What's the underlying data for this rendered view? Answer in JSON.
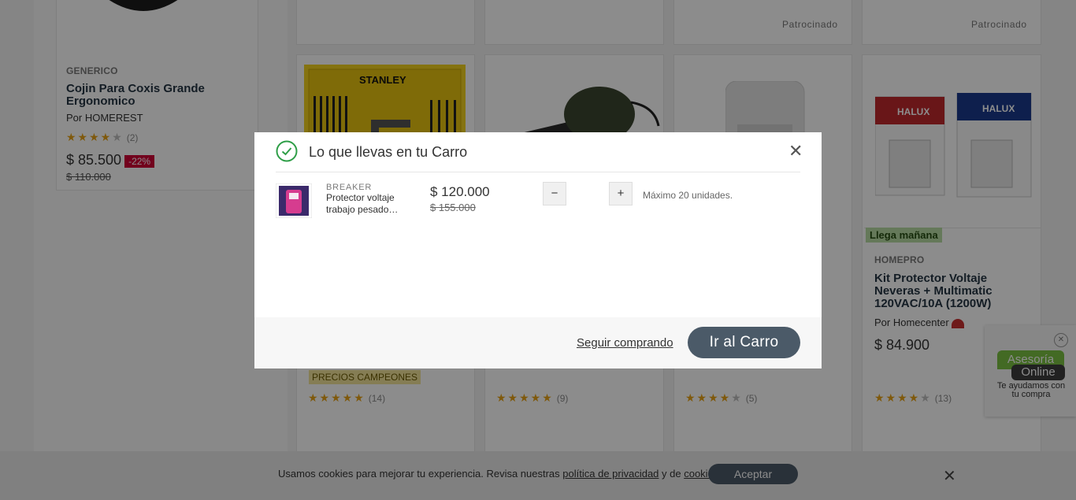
{
  "background": {
    "left_product": {
      "brand": "GENERICO",
      "title": "Cojin Para Coxis Grande Ergonomico",
      "seller": "Por HOMEREST",
      "rating_count": "(2)",
      "price": "$ 85.500",
      "discount": "-22%",
      "old_price": "$ 110.000"
    },
    "sponsored_labels": [
      "Patrocinado",
      "Patrocinado"
    ],
    "stanley_product": {
      "image_text": "STANLEY",
      "badge": "PRECIOS CAMPEONES",
      "rating_count": "(14)"
    },
    "blower_product": {
      "rating_count": "(9)"
    },
    "protector_product": {
      "rating_count": "(5)"
    },
    "halux_product": {
      "delivery_badge": "Llega mañana",
      "brand": "HOMEPRO",
      "title": "Kit Protector Voltaje Neveras + Multimatic 120VAC/10A (1200W)",
      "seller": "Por Homecenter",
      "price": "$ 84.900",
      "rating_count": "(13)",
      "image_text": [
        "HALUX",
        "HALUX"
      ]
    }
  },
  "cookie_bar": {
    "text_before": "Usamos cookies para mejorar tu experiencia. Revisa nuestras ",
    "privacy_link": "política de privacidad",
    "text_middle": " y de ",
    "cookies_link": "cookies",
    "text_after": ".",
    "accept_label": "Aceptar",
    "close_glyph": "✕"
  },
  "chat_widget": {
    "line1": "Asesoría",
    "line2": "Online",
    "subtitle": "Te ayudamos con tu compra",
    "close_glyph": "✕"
  },
  "modal": {
    "title": "Lo que llevas en tu Carro",
    "close_glyph": "✕",
    "item": {
      "brand": "BREAKER",
      "name": "Protector voltaje trabajo pesado…",
      "price": "$ 120.000",
      "old_price": "$ 155.000"
    },
    "qty_minus": "−",
    "qty_plus": "+",
    "max_message": "Máximo 20 unidades.",
    "keep_shopping": "Seguir comprando",
    "go_to_cart": "Ir al Carro"
  },
  "colors": {
    "primary_button": "#4b5a68",
    "discount_badge": "#d00036",
    "star": "#e8a317",
    "success_check": "#2e9e47",
    "delivery_badge": "#b9dca4"
  }
}
